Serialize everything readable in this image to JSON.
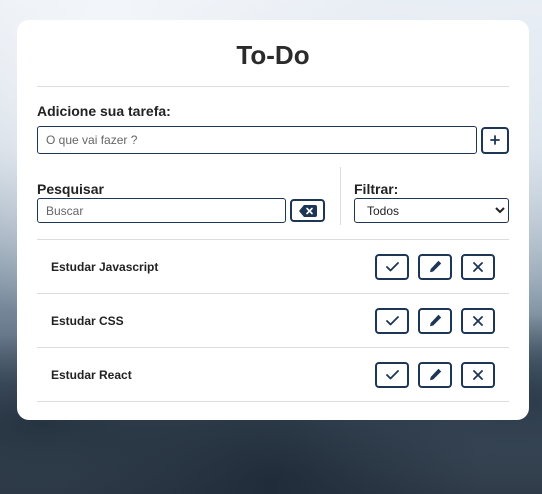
{
  "app": {
    "title": "To-Do"
  },
  "add_form": {
    "label": "Adicione sua tarefa:",
    "placeholder": "O que vai fazer ?",
    "value": "",
    "button_icon": "plus-icon"
  },
  "search": {
    "label": "Pesquisar",
    "placeholder": "Buscar",
    "value": "",
    "clear_icon": "backspace-icon"
  },
  "filter": {
    "label": "Filtrar:",
    "selected": "Todos",
    "options": [
      "Todos"
    ]
  },
  "todos": [
    {
      "title": "Estudar Javascript",
      "actions": [
        "check-icon",
        "pencil-icon",
        "close-icon"
      ]
    },
    {
      "title": "Estudar CSS",
      "actions": [
        "check-icon",
        "pencil-icon",
        "close-icon"
      ]
    },
    {
      "title": "Estudar React",
      "actions": [
        "check-icon",
        "pencil-icon",
        "close-icon"
      ]
    }
  ],
  "colors": {
    "accent": "#1d3656",
    "card": "#ffffff",
    "divider": "#dcdcdc"
  }
}
